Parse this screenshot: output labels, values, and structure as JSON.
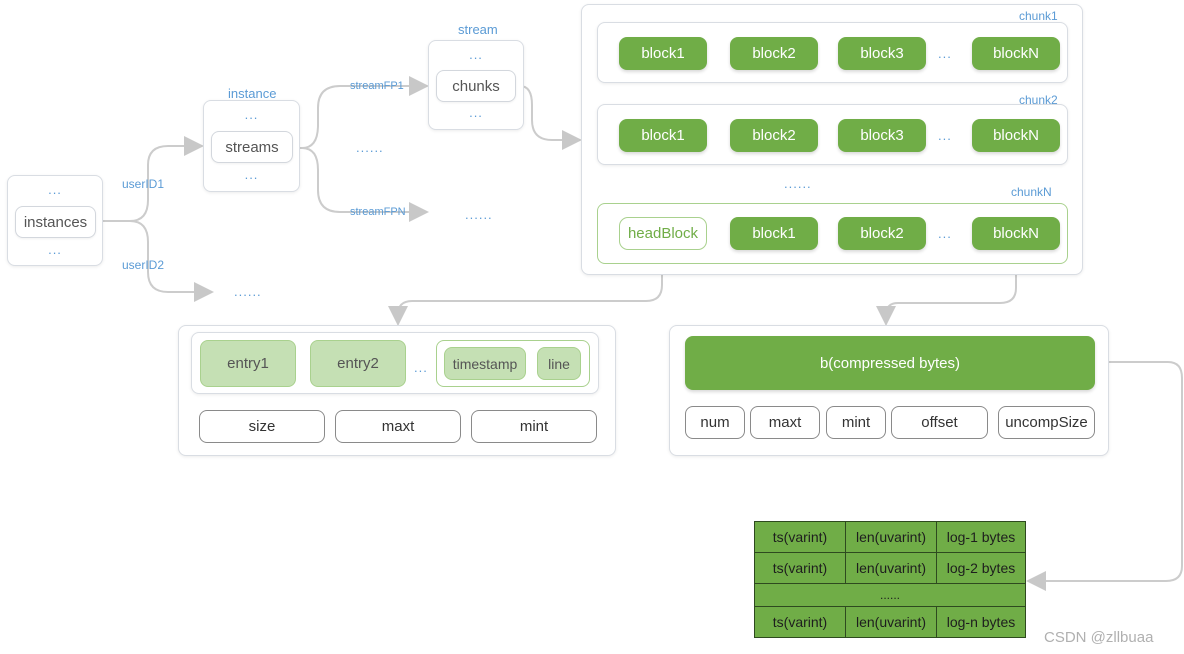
{
  "diagram": {
    "instances_box": {
      "top_dots": "...",
      "label": "instances",
      "bottom_dots": "..."
    },
    "instance_box": {
      "title": "instance",
      "top_dots": "...",
      "label": "streams",
      "bottom_dots": "..."
    },
    "stream_box": {
      "title": "stream",
      "top_dots": "...",
      "label": "chunks",
      "bottom_dots": "..."
    },
    "edge_labels": {
      "user1": "userID1",
      "user2": "userID2",
      "fp1": "streamFP1",
      "fpn": "streamFPN"
    },
    "ellipses": {
      "user2_target": "......",
      "streams_middle": "......",
      "fpn_target": "......",
      "chunks_middle": "......",
      "inline": "..."
    },
    "chunks": [
      {
        "name": "chunk1",
        "blocks": [
          "block1",
          "block2",
          "block3",
          "blockN"
        ]
      },
      {
        "name": "chunk2",
        "blocks": [
          "block1",
          "block2",
          "block3",
          "blockN"
        ]
      },
      {
        "name": "chunkN",
        "head": "headBlock",
        "blocks": [
          "block1",
          "block2",
          "blockN"
        ]
      }
    ],
    "head_block_detail": {
      "entries": [
        "entry1",
        "entry2"
      ],
      "entry_fields": [
        "timestamp",
        "line"
      ],
      "meta": [
        "size",
        "maxt",
        "mint"
      ]
    },
    "block_detail": {
      "data": "b(compressed bytes)",
      "meta": [
        "num",
        "maxt",
        "mint",
        "offset",
        "uncompSize"
      ]
    },
    "log_table": {
      "rows": [
        [
          "ts(varint)",
          "len(uvarint)",
          "log-1 bytes"
        ],
        [
          "ts(varint)",
          "len(uvarint)",
          "log-2 bytes"
        ],
        [
          "......"
        ],
        [
          "ts(varint)",
          "len(uvarint)",
          "log-n bytes"
        ]
      ]
    },
    "watermark": "CSDN @zllbuaa"
  },
  "colors": {
    "block_green": "#70ad47",
    "entry_green": "#c5e0b4",
    "label_blue": "#5b9bd5",
    "connector_gray": "#c8c8c8"
  }
}
